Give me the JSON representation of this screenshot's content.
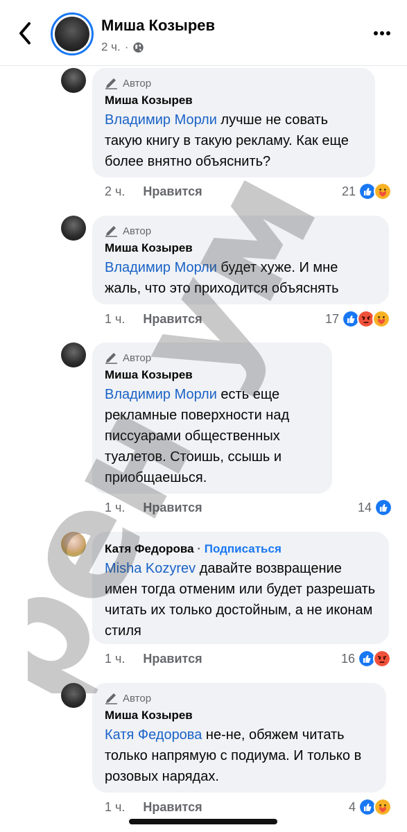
{
  "header": {
    "name": "Миша Козырев",
    "time": "2 ч.",
    "separator": "·"
  },
  "comments": [
    {
      "author_tag": "Автор",
      "name": "Миша Козырев",
      "mention": "Владимир Морли",
      "text": " лучше не совать такую книгу в такую рекламу. Как еще более внятно объяснить?",
      "time": "2 ч.",
      "like_label": "Нравится",
      "count": "21",
      "reactions": [
        "like-icon",
        "care-icon"
      ]
    },
    {
      "author_tag": "Автор",
      "name": "Миша Козырев",
      "mention": "Владимир Морли",
      "text": " будет хуже. И мне жаль, что это приходится объяснять",
      "time": "1 ч.",
      "like_label": "Нравится",
      "count": "17",
      "reactions": [
        "like-icon",
        "angry-icon",
        "care-icon"
      ]
    },
    {
      "author_tag": "Автор",
      "name": "Миша Козырев",
      "mention": "Владимир Морли",
      "text": " есть еще рекламные поверхности над писсуарами общественных туалетов. Стоишь, ссышь и приобщаешься.",
      "time": "1 ч.",
      "like_label": "Нравится",
      "count": "14",
      "reactions": [
        "like-icon"
      ]
    },
    {
      "name": "Катя Федорова",
      "name_separator": " · ",
      "subscribe": "Подписаться",
      "mention": "Misha Kozyrev",
      "text": " давайте возвращение имен тогда отменим или будет разрешать читать их только достойным, а не иконам стиля",
      "time": "1 ч.",
      "like_label": "Нравится",
      "count": "16",
      "reactions": [
        "like-icon",
        "angry-icon"
      ]
    },
    {
      "author_tag": "Автор",
      "name": "Миша Козырев",
      "mention": "Катя Федорова",
      "text": " не-не, обяжем читать только напрямую с подиума. И только в розовых нарядах.",
      "time": "1 ч.",
      "like_label": "Нравится",
      "count": "4",
      "reactions": [
        "like-icon",
        "care-icon"
      ]
    }
  ],
  "watermark": "рен ум",
  "colors": {
    "mention": "#1a62c7",
    "like": "#1877f2",
    "angry": "#f0513b",
    "care": "#f7b125",
    "bubble": "#f0f2f5"
  }
}
